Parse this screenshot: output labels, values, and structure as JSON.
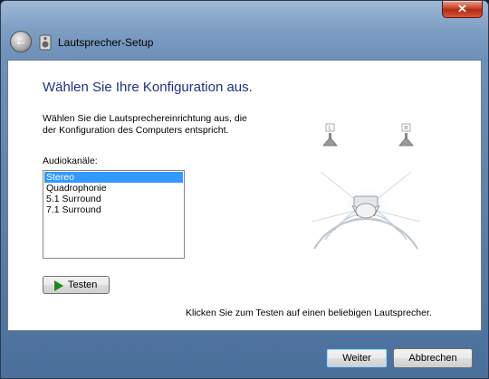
{
  "window": {
    "close_label": "✕"
  },
  "nav": {
    "title": "Lautsprecher-Setup"
  },
  "main": {
    "heading": "Wählen Sie Ihre Konfiguration aus.",
    "description_line1": "Wählen Sie die Lautsprechereinrichtung aus, die",
    "description_line2": "der Konfiguration des Computers entspricht.",
    "channels_label": "Audiokanäle:",
    "channels": [
      "Stereo",
      "Quadrophonie",
      "5.1 Surround",
      "7.1 Surround"
    ],
    "selected_channel": "Stereo",
    "test_button_label": "Testen",
    "hint": "Klicken Sie zum Testen auf einen beliebigen Lautsprecher.",
    "speaker_left_label": "L",
    "speaker_right_label": "R"
  },
  "footer": {
    "next_label": "Weiter",
    "cancel_label": "Abbrechen"
  },
  "colors": {
    "heading": "#1e3287",
    "selection": "#3399ff",
    "play_icon": "#1e8a1e"
  }
}
